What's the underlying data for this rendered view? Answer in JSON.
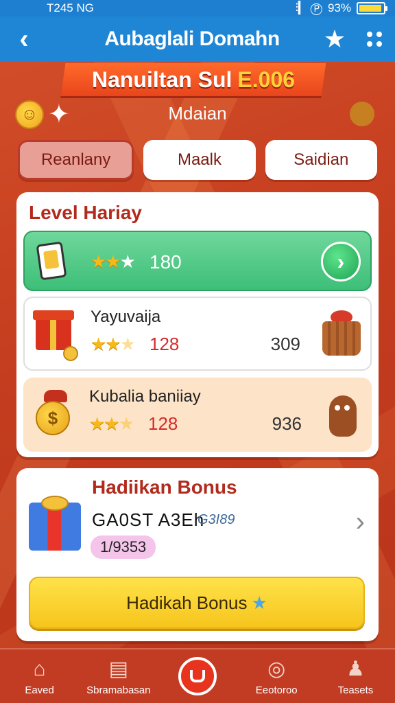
{
  "status_bar": {
    "time": "T245 NG",
    "signal": "⫶▎ Ⓟ",
    "battery_text": "93%",
    "battery_level": 0.93
  },
  "header": {
    "title": "Aubaglali Domahn"
  },
  "banner": {
    "text": "Nanuiltan Sul",
    "accent": "E.006"
  },
  "subtitle": "Mdaian",
  "tabs": [
    {
      "label": "Reanlany",
      "active": true
    },
    {
      "label": "Maalk",
      "active": false
    },
    {
      "label": "Saidian",
      "active": false
    }
  ],
  "level": {
    "title": "Level Hariay",
    "highlight": {
      "stars": "★★",
      "stars_empty": "★",
      "value": "180"
    },
    "rows": [
      {
        "name": "Yayuvaija",
        "stars": "★★",
        "stars_empty": "★",
        "value": "128",
        "count": "309"
      },
      {
        "name": "Kubalia baniiay",
        "stars": "★★",
        "stars_empty": "★",
        "value": "128",
        "count": "936"
      }
    ]
  },
  "bonus": {
    "title": "Hadiikan Bonus",
    "code": "GA0ST A3Eh",
    "code_small": "G3I89",
    "pill": "1/9353",
    "button_label": "Hadikah Bonus",
    "button_star": "★"
  },
  "bottom_nav": [
    {
      "label": "Eaved",
      "icon": "home-icon"
    },
    {
      "label": "Sbramabasan",
      "icon": "profile-card-icon"
    },
    {
      "label": "",
      "icon": "center-play-icon"
    },
    {
      "label": "Eeotoroo",
      "icon": "target-icon"
    },
    {
      "label": "Teasets",
      "icon": "user-icon"
    }
  ]
}
